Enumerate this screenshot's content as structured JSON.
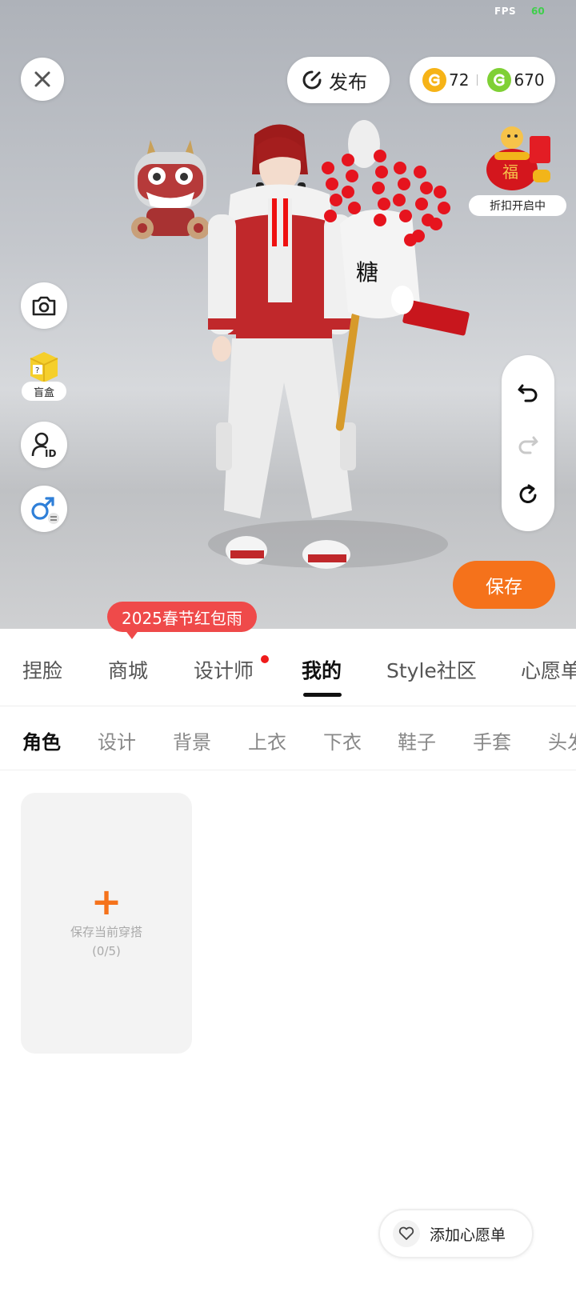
{
  "status": {
    "fps_label": "FPS",
    "fps_value": "60"
  },
  "header": {
    "close_icon": "close-icon",
    "publish_label": "发布",
    "coin_gold": {
      "value": "72",
      "color": "#f6b317"
    },
    "coin_green": {
      "value": "670",
      "color": "#7fd035"
    }
  },
  "promo_widget": {
    "label": "折扣开启中"
  },
  "left_tools": {
    "blind_box_label": "盲盒"
  },
  "actions": {
    "save_label": "保存"
  },
  "event_badge": {
    "label": "2025春节红包雨"
  },
  "main_tabs": [
    {
      "label": "捏脸"
    },
    {
      "label": "商城"
    },
    {
      "label": "设计师"
    },
    {
      "label": "我的"
    },
    {
      "label": "Style社区"
    },
    {
      "label": "心愿单"
    }
  ],
  "sub_tabs": [
    {
      "label": "角色"
    },
    {
      "label": "设计"
    },
    {
      "label": "背景"
    },
    {
      "label": "上衣"
    },
    {
      "label": "下衣"
    },
    {
      "label": "鞋子"
    },
    {
      "label": "手套"
    },
    {
      "label": "头发"
    }
  ],
  "outfit_slot": {
    "label": "保存当前穿搭",
    "count": "(0/5)"
  },
  "wishlist_button": {
    "label": "添加心愿单"
  },
  "colors": {
    "accent": "#f5721b",
    "promo_red": "#ef4a4a",
    "dot_red": "#ef1b1b"
  }
}
